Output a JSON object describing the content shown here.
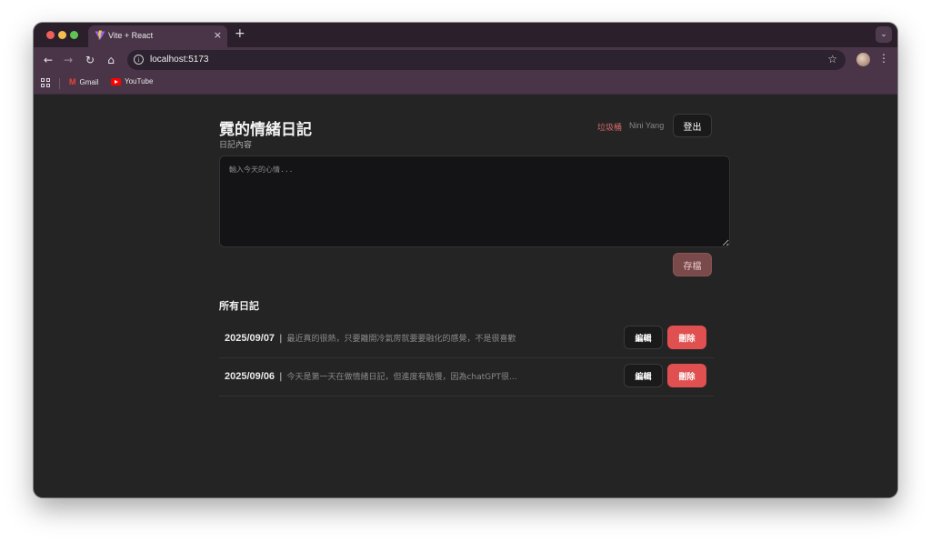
{
  "browser": {
    "tab_title": "Vite + React",
    "tab_close": "×",
    "new_tab": "+",
    "url": "localhost:5173",
    "icons": {
      "back": "←",
      "forward": "→",
      "reload": "↻",
      "home": "⌂",
      "star": "☆",
      "more": "⋮",
      "info": "i",
      "tab_menu": "⌄"
    },
    "bookmarks": [
      {
        "label": "Gmail",
        "icon": "gmail-icon"
      },
      {
        "label": "YouTube",
        "icon": "youtube-icon"
      }
    ]
  },
  "app": {
    "title": "霓的情緒日記",
    "trash_link": "垃圾桶",
    "user_name": "Nini Yang",
    "logout_label": "登出",
    "content_label": "日記內容",
    "textarea_placeholder": "輸入今天的心情...",
    "textarea_value": "",
    "save_label": "存檔",
    "list_heading": "所有日記",
    "entry_separator": "|",
    "edit_label": "編輯",
    "delete_label": "刪除",
    "entries": [
      {
        "date": "2025/09/07",
        "summary": "最近真的很熱，只要離開冷氣房就要要融化的感覺，不是很喜歡"
      },
      {
        "date": "2025/09/06",
        "summary": "今天是第一天在做情緒日記，但進度有點慢，因為chatGPT很..."
      }
    ]
  },
  "colors": {
    "page_bg": "#242424",
    "chrome_bg": "#4a3548",
    "accent_red": "#e05050",
    "trash_link": "#d46a6a",
    "save_disabled": "#7a4a4a"
  }
}
